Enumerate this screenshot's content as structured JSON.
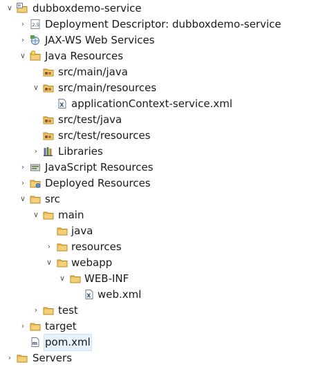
{
  "tree": [
    {
      "label": "dubboxdemo-service",
      "icon": "project-icon",
      "expanded": true
    },
    {
      "label": "Deployment Descriptor: dubboxdemo-service",
      "icon": "deployment-descriptor-icon",
      "expanded": false
    },
    {
      "label": "JAX-WS Web Services",
      "icon": "web-services-icon",
      "expanded": false
    },
    {
      "label": "Java Resources",
      "icon": "java-resources-icon",
      "expanded": true
    },
    {
      "label": "src/main/java",
      "icon": "source-folder-icon",
      "expanded": null
    },
    {
      "label": "src/main/resources",
      "icon": "source-folder-icon",
      "expanded": true
    },
    {
      "label": "applicationContext-service.xml",
      "icon": "xml-file-icon",
      "expanded": null
    },
    {
      "label": "src/test/java",
      "icon": "source-folder-icon",
      "expanded": null
    },
    {
      "label": "src/test/resources",
      "icon": "source-folder-icon",
      "expanded": null
    },
    {
      "label": "Libraries",
      "icon": "libraries-icon",
      "expanded": false
    },
    {
      "label": "JavaScript Resources",
      "icon": "javascript-resources-icon",
      "expanded": false
    },
    {
      "label": "Deployed Resources",
      "icon": "deployed-resources-icon",
      "expanded": false
    },
    {
      "label": "src",
      "icon": "folder-icon",
      "expanded": true
    },
    {
      "label": "main",
      "icon": "folder-icon",
      "expanded": true
    },
    {
      "label": "java",
      "icon": "folder-icon",
      "expanded": null
    },
    {
      "label": "resources",
      "icon": "folder-icon",
      "expanded": false
    },
    {
      "label": "webapp",
      "icon": "folder-icon",
      "expanded": true
    },
    {
      "label": "WEB-INF",
      "icon": "folder-icon",
      "expanded": true
    },
    {
      "label": "web.xml",
      "icon": "xml-file-icon",
      "expanded": null
    },
    {
      "label": "test",
      "icon": "folder-icon",
      "expanded": false
    },
    {
      "label": "target",
      "icon": "folder-icon",
      "expanded": false
    },
    {
      "label": "pom.xml",
      "icon": "maven-pom-file-icon",
      "expanded": null,
      "selected": true
    },
    {
      "label": "Servers",
      "icon": "folder-icon",
      "expanded": false
    }
  ],
  "colors": {
    "folder": "#e8b64a",
    "folder_dark": "#b98a24",
    "selection": "#e5f1fb",
    "text": "#1a1a1a"
  }
}
